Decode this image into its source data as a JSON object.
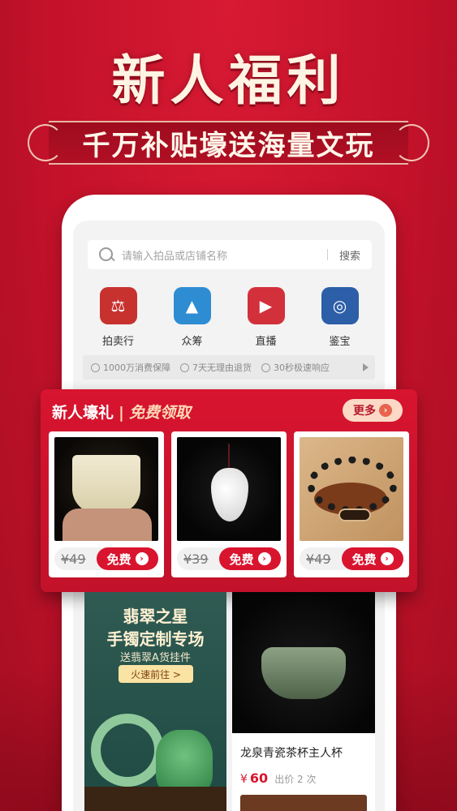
{
  "colors": {
    "brand_red": "#c4122a",
    "accent_red": "#d9142e",
    "cream": "#fff4e3"
  },
  "banner": {
    "headline": "新人福利",
    "subheadline": "千万补贴壕送海量文玩"
  },
  "app": {
    "search": {
      "placeholder": "请输入拍品或店铺名称",
      "button": "搜索"
    },
    "categories": [
      {
        "label": "拍卖行",
        "icon": "gavel-icon",
        "color": "#c7322f"
      },
      {
        "label": "众筹",
        "icon": "crowdfund-icon",
        "color": "#2e8cd3"
      },
      {
        "label": "直播",
        "icon": "live-video-icon",
        "color": "#d2303b"
      },
      {
        "label": "鉴宝",
        "icon": "appraise-icon",
        "color": "#2d5ea8"
      }
    ],
    "guarantees": [
      "1000万消费保障",
      "7天无理由退货",
      "30秒极速响应"
    ]
  },
  "gift": {
    "title": "新人壕礼",
    "separator": "|",
    "subtitle": "免费领取",
    "more": "更多",
    "items": [
      {
        "price": "¥49",
        "button": "免费"
      },
      {
        "price": "¥39",
        "button": "免费"
      },
      {
        "price": "¥49",
        "button": "免费"
      }
    ]
  },
  "feed": {
    "promo": {
      "title1": "翡翠之星",
      "title2": "手镯定制专场",
      "subtitle": "送翡翠A货挂件",
      "button": "火速前往 >"
    },
    "product": {
      "name": "龙泉青瓷茶杯主人杯",
      "currency": "¥",
      "price": "60",
      "bid_label": "出价 2 次"
    }
  }
}
